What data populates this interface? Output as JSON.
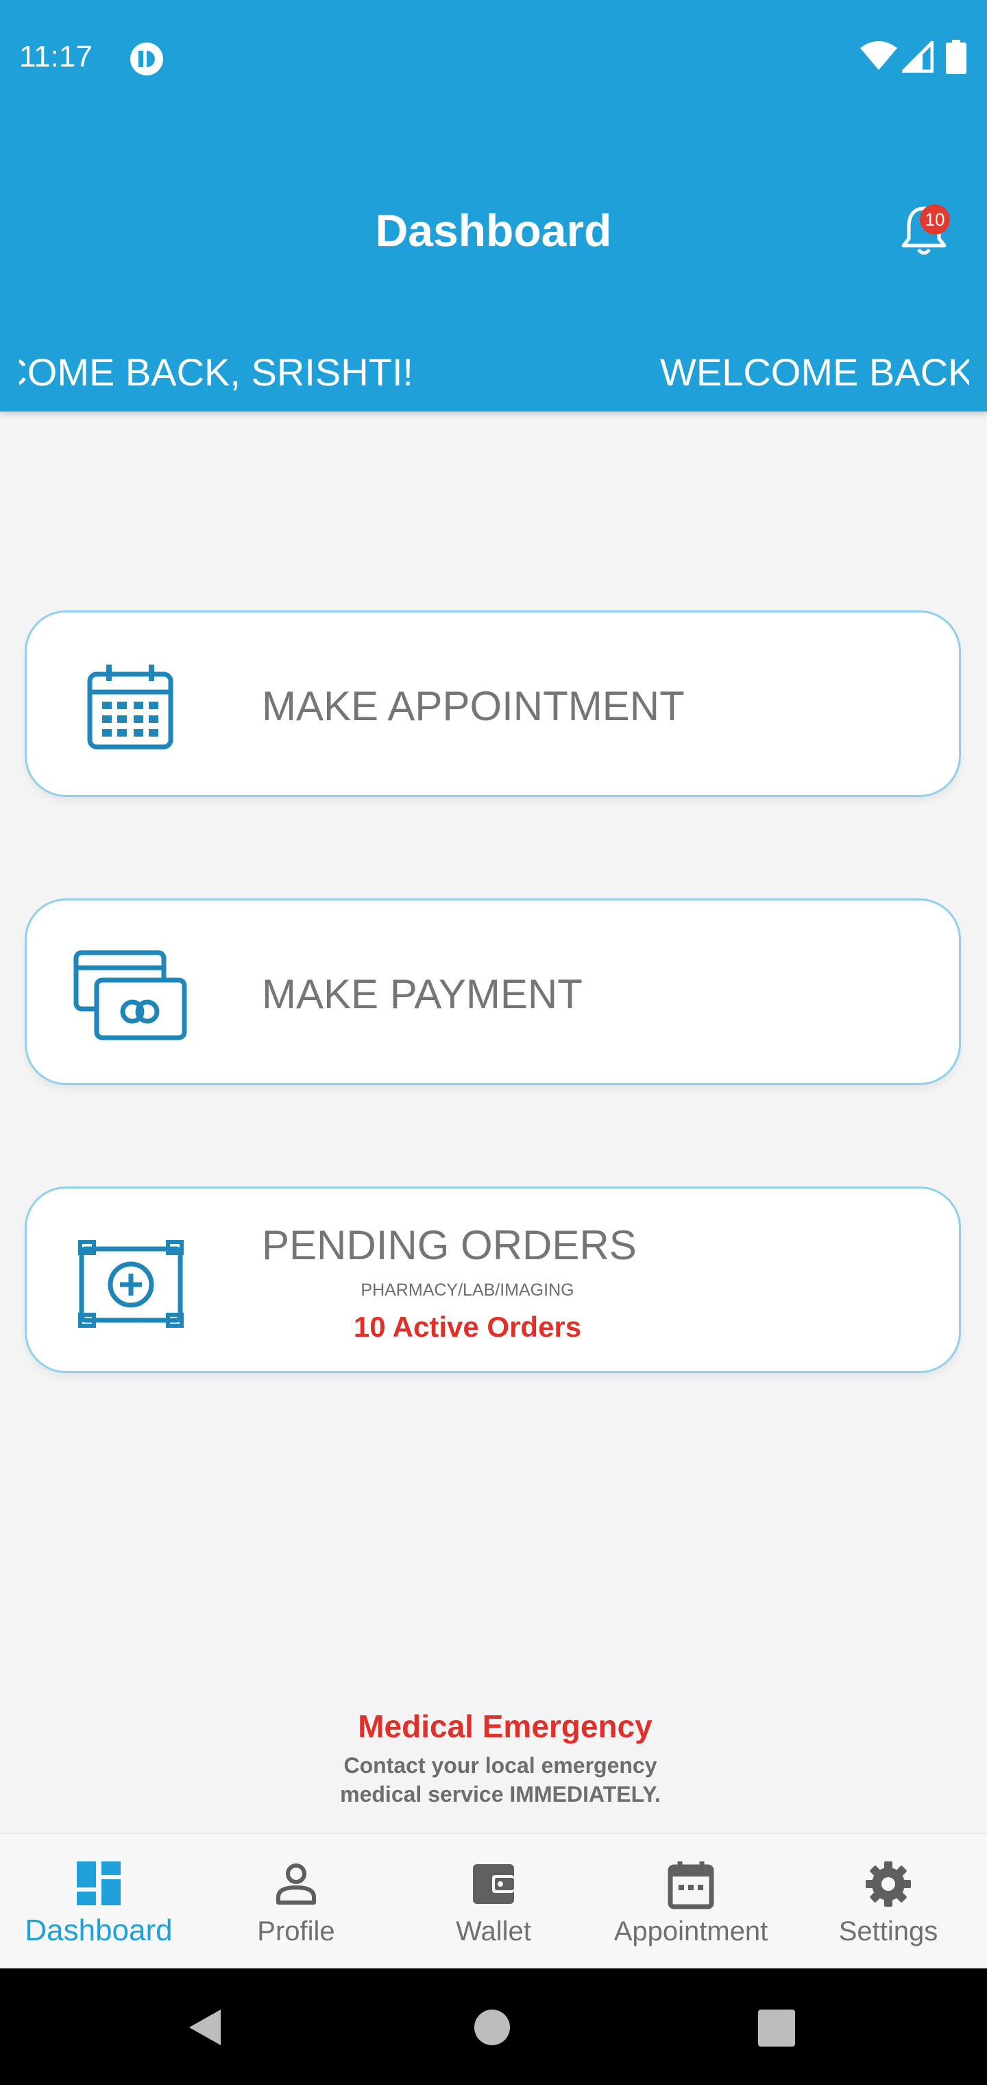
{
  "status_bar": {
    "time": "11:17"
  },
  "header": {
    "title": "Dashboard",
    "notification_count": "10",
    "marquee_text": "WELCOME BACK, SRISHTI!"
  },
  "cards": [
    {
      "label": "MAKE APPOINTMENT",
      "icon": "calendar-icon"
    },
    {
      "label": "MAKE PAYMENT",
      "icon": "payment-cards-icon"
    },
    {
      "label": "PENDING ORDERS",
      "icon": "medical-kit-icon",
      "sub": "PHARMACY/LAB/IMAGING",
      "active": "10 Active Orders"
    }
  ],
  "emergency": {
    "title": "Medical Emergency",
    "line1": "Contact your local emergency",
    "line2": "medical service IMMEDIATELY."
  },
  "bottom_nav": [
    {
      "label": "Dashboard",
      "icon": "dashboard-icon",
      "active": true
    },
    {
      "label": "Profile",
      "icon": "person-icon",
      "active": false
    },
    {
      "label": "Wallet",
      "icon": "wallet-icon",
      "active": false
    },
    {
      "label": "Appointment",
      "icon": "calendar-icon",
      "active": false
    },
    {
      "label": "Settings",
      "icon": "gear-icon",
      "active": false
    }
  ],
  "colors": {
    "primary": "#1fa0d9",
    "alert": "#e0302a",
    "card_border": "#8fd0ee",
    "text_gray": "#757575",
    "icon_blue": "#1e86b8"
  }
}
